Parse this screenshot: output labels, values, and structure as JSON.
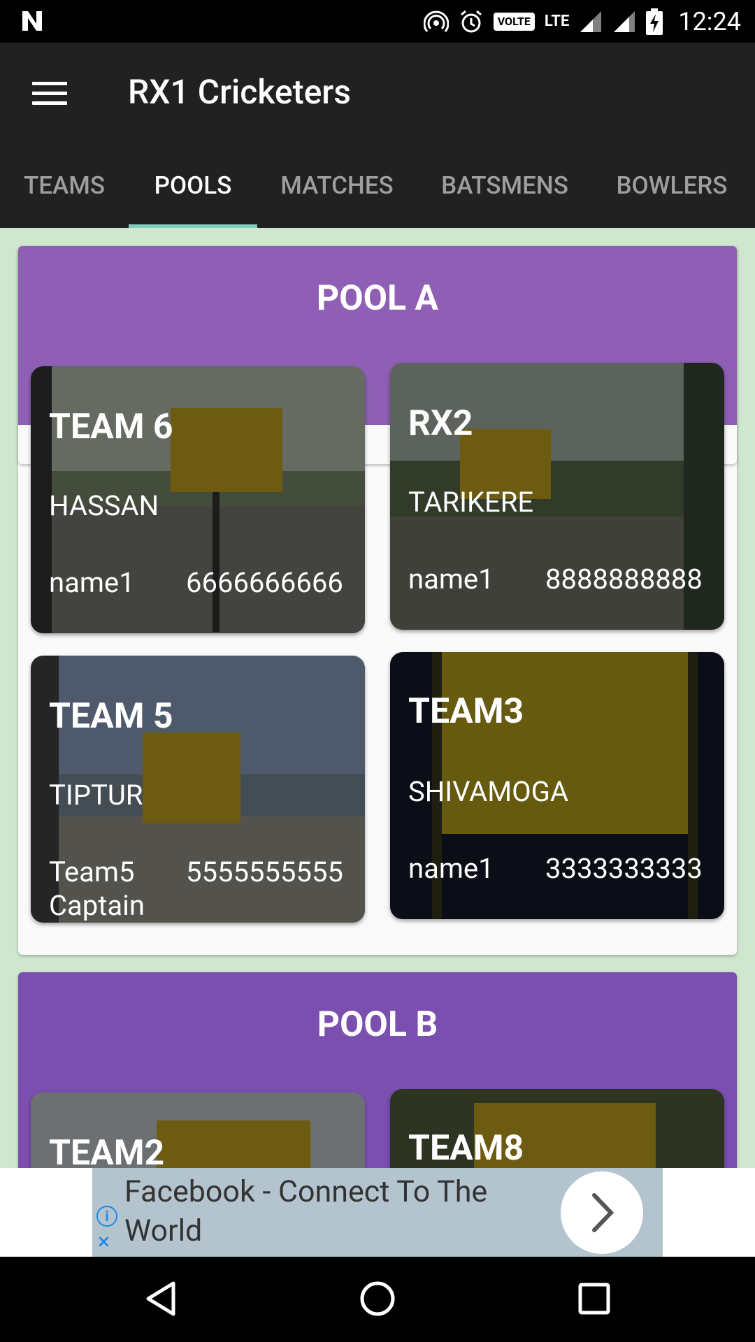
{
  "status_bar": {
    "time": "12:24",
    "volte": "VOLTE",
    "lte": "LTE"
  },
  "app_bar": {
    "title": "RX1 Cricketers"
  },
  "tabs": [
    {
      "label": "TEAMS"
    },
    {
      "label": "POOLS"
    },
    {
      "label": "MATCHES"
    },
    {
      "label": "BATSMENS"
    },
    {
      "label": "BOWLERS"
    }
  ],
  "active_tab": "POOLS",
  "pools": [
    {
      "title": "POOL A",
      "header_color": "#8e5fb4",
      "teams": [
        {
          "name": "TEAM 6",
          "city": "HASSAN",
          "captain": "name1",
          "phone": "6666666666"
        },
        {
          "name": "RX2",
          "city": "TARIKERE",
          "captain": "name1",
          "phone": "8888888888"
        },
        {
          "name": "TEAM 5",
          "city": "TIPTUR",
          "captain": "Team5 Captain",
          "phone": "5555555555"
        },
        {
          "name": "TEAM3",
          "city": "SHIVAMOGA",
          "captain": "name1",
          "phone": "3333333333"
        }
      ]
    },
    {
      "title": "POOL B",
      "header_color": "#7a4fb0",
      "teams": [
        {
          "name": "TEAM2"
        },
        {
          "name": "TEAM8"
        }
      ]
    }
  ],
  "ad": {
    "text": "Facebook - Connect To The World"
  }
}
